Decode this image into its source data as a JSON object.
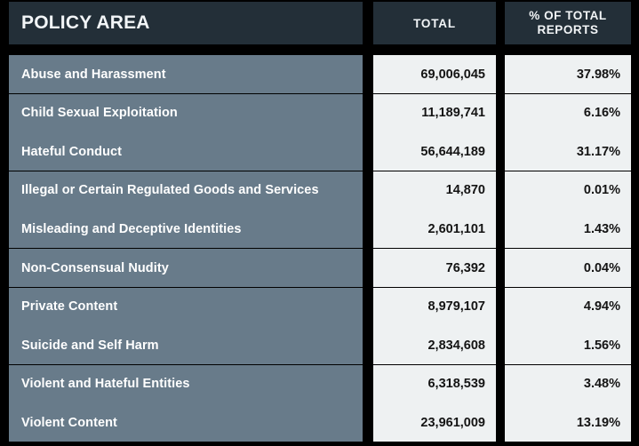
{
  "table": {
    "columns": [
      {
        "key": "policy_area",
        "label": "POLICY AREA",
        "align": "left"
      },
      {
        "key": "total",
        "label": "TOTAL",
        "align": "center"
      },
      {
        "key": "pct_of_total_reports",
        "label_line1": "% OF TOTAL",
        "label_line2": "REPORTS",
        "align": "center"
      }
    ],
    "colors": {
      "page_background": "#000000",
      "header_background": "#232f38",
      "header_text": "#f2f5f7",
      "row_label_background": "#687b8a",
      "row_label_text": "#ffffff",
      "value_cell_background": "#eef1f2",
      "value_cell_text": "#141414"
    },
    "rows": [
      {
        "policy_area": "Abuse and Harassment",
        "total": "69,006,045",
        "pct": "37.98%"
      },
      {
        "policy_area": "Child Sexual Exploitation",
        "total": "11,189,741",
        "pct": "6.16%"
      },
      {
        "policy_area": "Hateful Conduct",
        "total": "56,644,189",
        "pct": "31.17%"
      },
      {
        "policy_area": "Illegal or Certain Regulated Goods and Services",
        "total": "14,870",
        "pct": "0.01%"
      },
      {
        "policy_area": "Misleading and Deceptive Identities",
        "total": "2,601,101",
        "pct": "1.43%"
      },
      {
        "policy_area": "Non-Consensual Nudity",
        "total": "76,392",
        "pct": "0.04%"
      },
      {
        "policy_area": "Private Content",
        "total": "8,979,107",
        "pct": "4.94%"
      },
      {
        "policy_area": "Suicide and Self Harm",
        "total": "2,834,608",
        "pct": "1.56%"
      },
      {
        "policy_area": "Violent and Hateful Entities",
        "total": "6,318,539",
        "pct": "3.48%"
      },
      {
        "policy_area": "Violent Content",
        "total": "23,961,009",
        "pct": "13.19%"
      }
    ]
  }
}
